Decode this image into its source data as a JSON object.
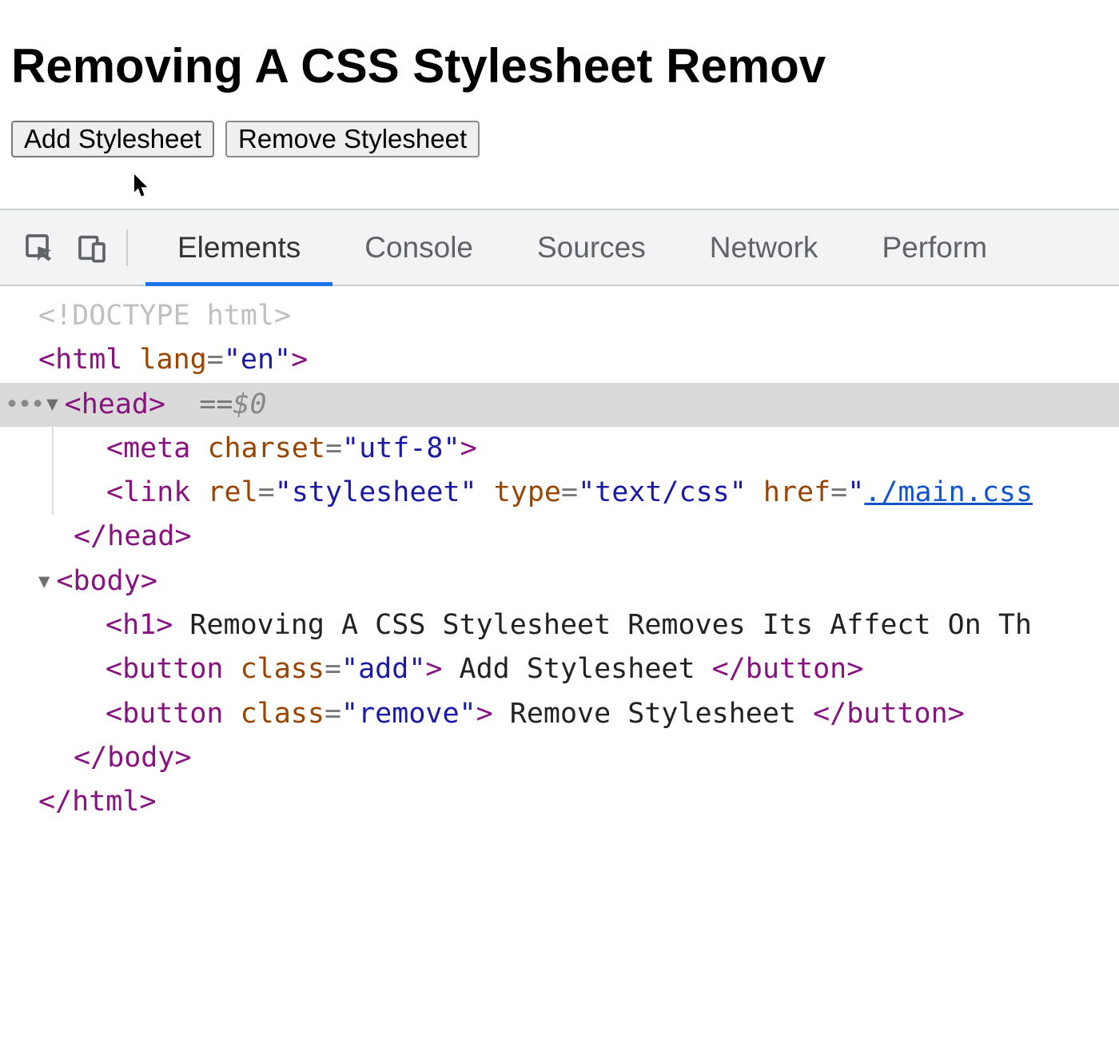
{
  "page": {
    "heading": "Removing A CSS Stylesheet Remov",
    "buttons": {
      "add": "Add Stylesheet",
      "remove": "Remove Stylesheet"
    }
  },
  "devtools": {
    "tabs": {
      "elements": "Elements",
      "console": "Console",
      "sources": "Sources",
      "network": "Network",
      "performance": "Perform"
    }
  },
  "dom": {
    "doctype": "<!DOCTYPE html>",
    "html_open_pre": "<",
    "html_tag": "html",
    "html_lang_attr": "lang",
    "html_lang_eq": "=",
    "html_lang_val": "\"en\"",
    "gt": ">",
    "lt_slash": "</",
    "head_tag": "head",
    "head_eqeq": "== ",
    "head_dollar": "$0",
    "meta_tag": "meta",
    "meta_charset_attr": "charset",
    "meta_charset_val": "\"utf-8\"",
    "link_tag": "link",
    "link_rel_attr": "rel",
    "link_rel_val": "\"stylesheet\"",
    "link_type_attr": "type",
    "link_type_val": "\"text/css\"",
    "link_href_attr": "href",
    "link_href_q": "\"",
    "link_href_url": "./main.css",
    "head_close": "head",
    "body_tag": "body",
    "h1_tag": "h1",
    "h1_text": " Removing A CSS Stylesheet Removes Its Affect On Th",
    "button_tag": "button",
    "class_attr": "class",
    "class_add_val": "\"add\"",
    "class_remove_val": "\"remove\"",
    "btn_add_text": " Add Stylesheet ",
    "btn_remove_text": " Remove Stylesheet ",
    "body_close": "body",
    "html_close": "html"
  }
}
